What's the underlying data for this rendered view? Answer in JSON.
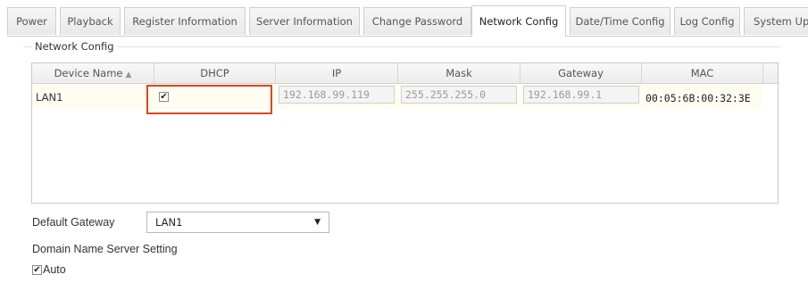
{
  "tabs": [
    {
      "label": "Power",
      "active": false
    },
    {
      "label": "Playback",
      "active": false
    },
    {
      "label": "Register Information",
      "active": false
    },
    {
      "label": "Server Information",
      "active": false
    },
    {
      "label": "Change Password",
      "active": false
    },
    {
      "label": "Network Config",
      "active": true
    },
    {
      "label": "Date/Time Config",
      "active": false
    },
    {
      "label": "Log Config",
      "active": false
    },
    {
      "label": "System Upg",
      "active": false
    }
  ],
  "network_config": {
    "legend": "Network Config",
    "columns": {
      "device_name": "Device Name",
      "dhcp": "DHCP",
      "ip": "IP",
      "mask": "Mask",
      "gateway": "Gateway",
      "mac": "MAC"
    },
    "sort_icon": "sort-icon",
    "rows": [
      {
        "device_name": "LAN1",
        "dhcp_checked": true,
        "ip": "192.168.99.119",
        "mask": "255.255.255.0",
        "gateway": "192.168.99.1",
        "mac": "00:05:6B:00:32:3E"
      }
    ]
  },
  "default_gateway": {
    "label": "Default Gateway",
    "value": "LAN1"
  },
  "dns": {
    "heading": "Domain Name Server Setting",
    "auto_label": "Auto",
    "auto_checked": true
  },
  "colors": {
    "highlight": "#e0451b",
    "row_background": "#fffdf1"
  }
}
